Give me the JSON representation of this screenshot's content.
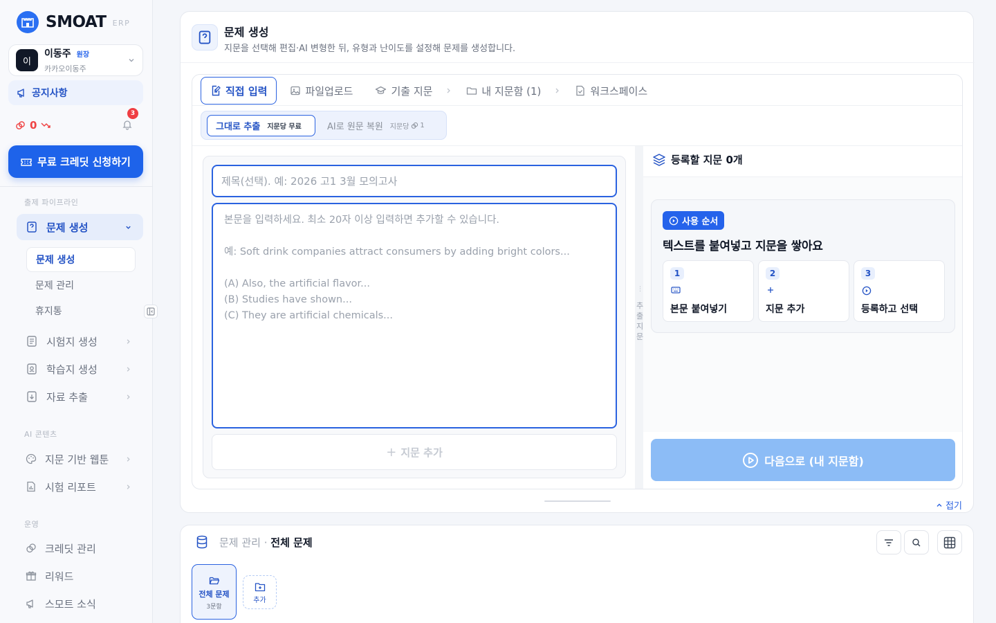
{
  "brand": {
    "name": "SMOAT",
    "sub": "ERP"
  },
  "user": {
    "initial": "이",
    "name": "이동주",
    "role": "원장",
    "org": "카카오이동주"
  },
  "sidebar": {
    "notice": "공지사항",
    "credit": "0",
    "bell_count": "3",
    "cta": "무료 크레딧 신청하기",
    "sections": {
      "pipeline": "출제 파이프라인",
      "ai": "AI 콘텐츠",
      "ops": "운영"
    },
    "items": {
      "question_gen": "문제 생성",
      "exam_gen": "시험지 생성",
      "study_gen": "학습지 생성",
      "export": "자료 추출",
      "webtoon": "지문 기반 웹툰",
      "report": "시험 리포트",
      "credit_mgmt": "크레딧 관리",
      "reward": "리워드",
      "news": "스모트 소식"
    },
    "sub_items": [
      "문제 생성",
      "문제 관리",
      "휴지통"
    ]
  },
  "header": {
    "title": "문제 생성",
    "desc": "지문을 선택해 편집·AI 변형한 뒤, 유형과 난이도를 설정해 문제를 생성합니다."
  },
  "tabs": {
    "direct": "직접 입력",
    "upload": "파일업로드",
    "past": "기출 지문",
    "mine": "내 지문함 (1)",
    "workspace": "워크스페이스"
  },
  "modes": {
    "extract": "그대로 추출",
    "extract_note": "지문당 무료",
    "restore": "AI로 원문 복원",
    "restore_note": "지문당",
    "restore_cost": "1"
  },
  "editor": {
    "title_placeholder": "제목(선택). 예: 2026 고1 3월 모의고사",
    "body_placeholder": "본문을 입력하세요. 최소 20자 이상 입력하면 추가할 수 있습니다.\n\n예: Soft drink companies attract consumers by adding bright colors...\n\n(A) Also, the artificial flavor...\n(B) Studies have shown...\n(C) They are artificial chemicals...",
    "add_label": "지문 추가"
  },
  "split_label": "추출지문",
  "right": {
    "header": "등록할 지문 0개",
    "guide_badge": "사용 순서",
    "guide_title": "텍스트를 붙여넣고 지문을 쌓아요",
    "steps": [
      {
        "num": "1",
        "label": "본문 붙여넣기",
        "icon": "keyboard-icon"
      },
      {
        "num": "2",
        "label": "지문 추가",
        "icon": "plus-icon"
      },
      {
        "num": "3",
        "label": "등록하고 선택",
        "icon": "play-circle-icon"
      }
    ],
    "next": "다음으로 (내 지문함)"
  },
  "fold": "접기",
  "bottom": {
    "prefix": "문제 관리 · ",
    "title": "전체 문제",
    "folder_name": "전체 문제",
    "folder_count": "3문항",
    "add_label": "추가"
  },
  "colors": {
    "primary": "#1e63ea",
    "accent_light": "#edf2fd",
    "danger": "#ef4444",
    "disabled_btn": "#8cbcf6"
  }
}
